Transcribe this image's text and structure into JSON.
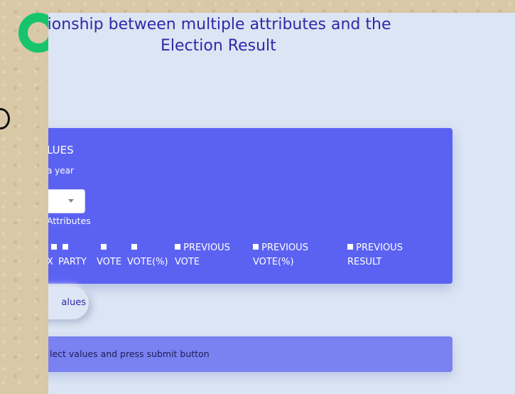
{
  "title": {
    "line1": "tionship between multiple attributes and the",
    "line2": "Election Result"
  },
  "form": {
    "heading": "LUES",
    "subheading": "a year",
    "year_select": {
      "value": ""
    },
    "attributes_label": "Attributes",
    "checkboxes": [
      {
        "label": "X",
        "checked": false
      },
      {
        "label": "PARTY",
        "checked": false
      },
      {
        "label": "VOTE",
        "checked": false
      },
      {
        "label": "VOTE(%)",
        "checked": false
      },
      {
        "label": "PREVIOUS VOTE",
        "checked": false
      },
      {
        "label": "PREVIOUS VOTE(%)",
        "checked": false
      },
      {
        "label": "PREVIOUS RESULT",
        "checked": false
      }
    ],
    "submit_label": "alues"
  },
  "result": {
    "message": "lect values and press submit button"
  },
  "colors": {
    "background": "#d8c8a6",
    "panel": "#dbe5f3",
    "card": "#5b62f2",
    "result": "#7a81f1",
    "title": "#2c2aa8",
    "logo": "#17c46c"
  },
  "icons": {
    "logo": "green-ring-logo",
    "ring": "ring-icon"
  }
}
